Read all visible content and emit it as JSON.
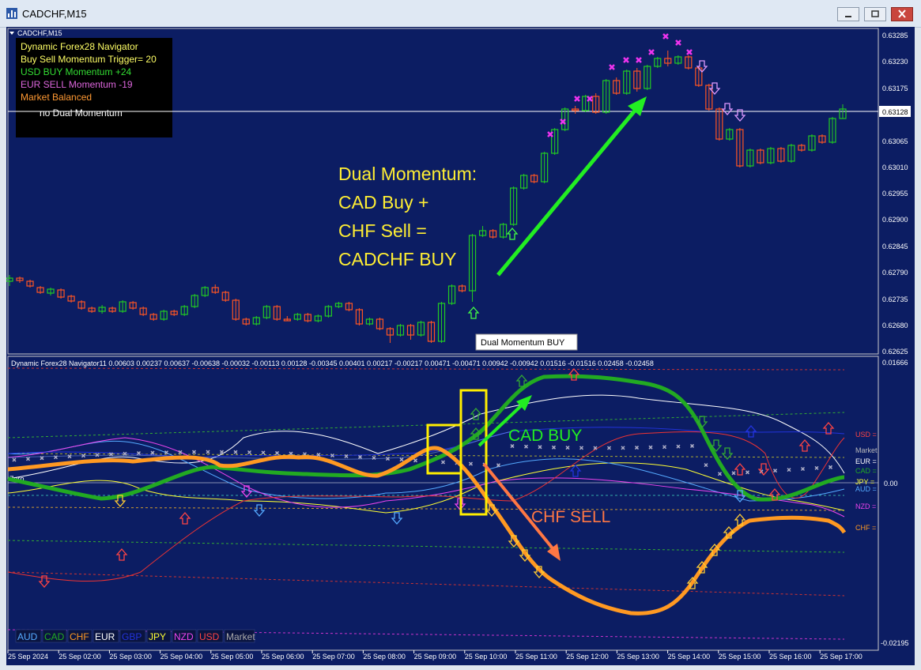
{
  "window": {
    "title": "CADCHF,M15"
  },
  "chart_symbol_label": "CADCHF,M15",
  "info_panel": {
    "lines": [
      {
        "text": "Dynamic Forex28 Navigator",
        "color": "#ffff66"
      },
      {
        "text": "Buy Sell Momentum Trigger= 20",
        "color": "#ffff66"
      },
      {
        "text": "USD BUY Momentum +24",
        "color": "#33dd33"
      },
      {
        "text": "EUR SELL Momentum -19",
        "color": "#dd66dd"
      },
      {
        "text": "Market Balanced",
        "color": "#ff9933"
      }
    ],
    "status": "no Dual Momentum"
  },
  "annotation": {
    "lines": [
      "Dual Momentum:",
      "CAD Buy +",
      "CHF Sell =",
      "CADCHF BUY"
    ],
    "color": "#ffee33"
  },
  "tooltip": "Dual Momentum BUY",
  "price_axis": {
    "labels": [
      "0.63285",
      "0.63230",
      "0.63175",
      "0.63065",
      "0.63010",
      "0.62955",
      "0.62900",
      "0.62845",
      "0.62790",
      "0.62735",
      "0.62680",
      "0.62625"
    ],
    "current_price": "0.63128"
  },
  "indicator": {
    "header": "Dynamic Forex28 Navigator11 0.00603 0.00237 0.00637 -0.00638 -0.00032 -0.00113 0.00128 -0.00345 0.00401 0.00217 -0.00217 0.00471 -0.00471 0.00942 -0.00942 0.01516 -0.01516 0.02458 -0.02458",
    "zero_label": "Zero",
    "axis": {
      "top": "0.01666",
      "mid": "0.00",
      "bottom": "-0.02195"
    },
    "right_labels": [
      {
        "text": "USD =",
        "color": "#ff4444"
      },
      {
        "text": "Market",
        "color": "#bbbbbb"
      },
      {
        "text": "EUR =",
        "color": "#ffffff"
      },
      {
        "text": "CAD =",
        "color": "#22aa22"
      },
      {
        "text": "JPY =",
        "color": "#ffff33"
      },
      {
        "text": "AUD =",
        "color": "#55aaff"
      },
      {
        "text": "NZD =",
        "color": "#ee44ee"
      },
      {
        "text": "CHF =",
        "color": "#ff9922"
      }
    ],
    "legend": [
      {
        "text": "AUD",
        "color": "#55aaff"
      },
      {
        "text": "CAD",
        "color": "#22aa22"
      },
      {
        "text": "CHF",
        "color": "#ff9922"
      },
      {
        "text": "EUR",
        "color": "#ffffff"
      },
      {
        "text": "GBP",
        "color": "#2233dd"
      },
      {
        "text": "JPY",
        "color": "#ffff33"
      },
      {
        "text": "NZD",
        "color": "#ee44ee"
      },
      {
        "text": "USD",
        "color": "#ff4444"
      },
      {
        "text": "Market",
        "color": "#aaaaaa"
      }
    ],
    "cad_label": "CAD BUY",
    "chf_label": "CHF SELL"
  },
  "time_axis": [
    "25 Sep 2024",
    "25 Sep 02:00",
    "25 Sep 03:00",
    "25 Sep 04:00",
    "25 Sep 05:00",
    "25 Sep 06:00",
    "25 Sep 07:00",
    "25 Sep 08:00",
    "25 Sep 09:00",
    "25 Sep 10:00",
    "25 Sep 11:00",
    "25 Sep 12:00",
    "25 Sep 13:00",
    "25 Sep 14:00",
    "25 Sep 15:00",
    "25 Sep 16:00",
    "25 Sep 17:00"
  ],
  "colors": {
    "background": "#0c1d63",
    "bull": "#22cc22",
    "bear": "#ff5522",
    "cad": "#22aa22",
    "chf": "#ff9922",
    "arrow_green": "#22ee22",
    "arrow_orange": "#ff7744",
    "highlight": "#ffee00"
  }
}
